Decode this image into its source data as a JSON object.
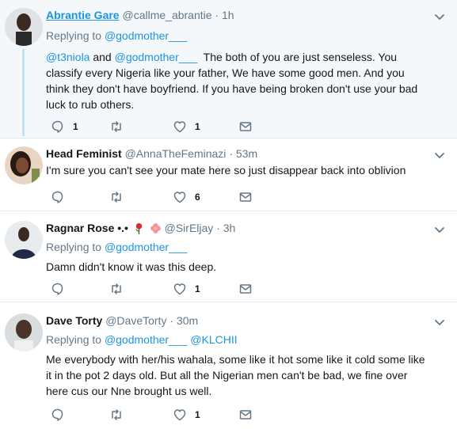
{
  "tweets": [
    {
      "name": "Abrantie Gare",
      "handle": "@callme_abrantie",
      "time": "1h",
      "replying_label": "Replying to",
      "replying_to": [
        "@godmother___"
      ],
      "body_mentions": [
        "@t3niola",
        "and",
        "@godmother___"
      ],
      "body_text": "The both of you are just senseless. You classify every Nigeria like your father, We have some good men. And you think they don't have boyfriend. If you have being broken don't use your bad luck to rub others.",
      "replies": "1",
      "retweets": "",
      "likes": "1"
    },
    {
      "name": "Head Feminist",
      "handle": "@AnnaTheFeminazi",
      "time": "53m",
      "body_text": "I'm sure you can't see your mate here so just disappear back into oblivion",
      "replies": "",
      "retweets": "",
      "likes": "6"
    },
    {
      "name": "Ragnar Rose •.•",
      "handle": "@SirEljay",
      "time": "3h",
      "replying_label": "Replying to",
      "replying_to": [
        "@godmother___"
      ],
      "body_text": "Damn didn't know it was this deep.",
      "replies": "",
      "retweets": "",
      "likes": "1"
    },
    {
      "name": "Dave Torty",
      "handle": "@DaveTorty",
      "time": "30m",
      "replying_label": "Replying to",
      "replying_to": [
        "@godmother___",
        "@KLCHII"
      ],
      "body_text": "Me everybody with her/his wahala, some like it hot some like it cold some like it in the pot 2 days old. But all the Nigerian men can't be bad, we fine over here cus our Nne brought us well.",
      "replies": "",
      "retweets": "",
      "likes": "1"
    }
  ],
  "separator": "·",
  "icons": {
    "reply": "reply-icon",
    "retweet": "retweet-icon",
    "like": "heart-icon",
    "dm": "envelope-icon",
    "more": "chevron-down-icon",
    "emoji1": "rose-emoji",
    "emoji2": "flower-emoji"
  },
  "colors": {
    "link": "#1b95e0",
    "muted": "#657786",
    "text": "#14171a",
    "thread_line": "#c4e0f5",
    "highlight_bg": "#f5f8fa"
  }
}
